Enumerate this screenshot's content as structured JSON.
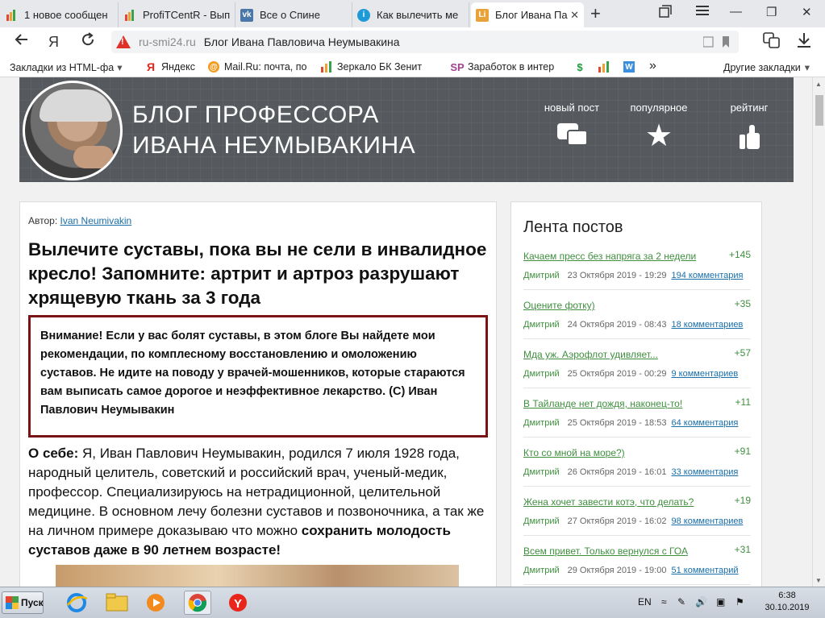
{
  "browser": {
    "tabs": [
      {
        "label": "1 новое сообщен",
        "icon": "chart-bars-icon",
        "color": "#e04a2f"
      },
      {
        "label": "ProfiTCentR - Вып",
        "icon": "chart-bars-icon",
        "color": "#e04a2f"
      },
      {
        "label": "Все о Спине",
        "icon": "vk-icon",
        "color": "#4a76a8"
      },
      {
        "label": "Как вылечить ме",
        "icon": "info-drop-icon",
        "color": "#1e9bd7"
      },
      {
        "label": "Блог Ивана Па",
        "icon": "blog-favicon-icon",
        "color": "#e8a23a"
      }
    ],
    "new_tab": "+",
    "window_controls": {
      "minimize": "—",
      "maximize": "❐",
      "close": "✕"
    },
    "address": {
      "domain": "ru-smi24.ru",
      "page_title": "Блог Ивана Павловича Неумывакина",
      "logo": "Я"
    },
    "bookmarks": [
      {
        "label": "Закладки из HTML-фа",
        "icon": "folder-icon"
      },
      {
        "label": "Яндекс",
        "icon": "yandex-icon"
      },
      {
        "label": "Mail.Ru: почта, по",
        "icon": "mailru-icon"
      },
      {
        "label": "Зеркало БК Зенит",
        "icon": "zenit-icon"
      },
      {
        "label": "Заработок в интер",
        "icon": "sp-icon"
      }
    ],
    "bookmarks_more": "»",
    "other_bookmarks": "Другие закладки"
  },
  "blog": {
    "title_line1": "БЛОГ ПРОФЕССОРА",
    "title_line2": "ИВАНА НЕУМЫВАКИНА",
    "nav": [
      {
        "label": "новый пост",
        "icon": "chat-bubbles-icon"
      },
      {
        "label": "популярное",
        "icon": "star-icon"
      },
      {
        "label": "рейтинг",
        "icon": "thumbs-up-icon"
      }
    ]
  },
  "article": {
    "author_label": "Автор:",
    "author_name": "Ivan Neumivakin",
    "headline": "Вылечите суставы, пока вы не сели в инвалидное кресло! Запомните: артрит и артроз разрушают хрящевую ткань за 3 года",
    "notice": "Внимание! Если у вас болят суставы, в этом блоге Вы найдете мои рекомендации, по комплесному восстановлению и омоложению суставов. Не идите на поводу у врачей-мошенников, которые стараются вам выписать самое дорогое и неэффективное лекарство. (С) Иван Павлович Неумывакин",
    "about_label": "О себе:",
    "about_text": " Я, Иван Павлович Неумывакин, родился 7 июля 1928 года, народный целитель, советский и российский врач, ученый-медик, профессор. Специализируюсь на нетрадиционной, целительной медицине. В основном лечу болезни суставов и позвоночника, а так же на личном примере доказываю что можно ",
    "about_bold_end": "сохранить молодость суставов даже в 90 летнем возрасте!"
  },
  "sidebar": {
    "title": "Лента постов",
    "posts": [
      {
        "title": "Качаем пресс без напряга за 2 недели",
        "score": "+145",
        "author": "Дмитрий",
        "date": "23 Октября 2019 - 19:29",
        "comments": "194 комментария"
      },
      {
        "title": "Оцените фотку)",
        "score": "+35",
        "author": "Дмитрий",
        "date": "24 Октября 2019 - 08:43",
        "comments": "18 комментариев"
      },
      {
        "title": "Мда уж. Аэрофлот удивляет...",
        "score": "+57",
        "author": "Дмитрий",
        "date": "25 Октября 2019 - 00:29",
        "comments": "9 комментариев"
      },
      {
        "title": "В Тайланде нет дождя, наконец-то!",
        "score": "+11",
        "author": "Дмитрий",
        "date": "25 Октября 2019 - 18:53",
        "comments": "64 комментария"
      },
      {
        "title": "Кто со мной на море?)",
        "score": "+91",
        "author": "Дмитрий",
        "date": "26 Октября 2019 - 16:01",
        "comments": "33 комментария"
      },
      {
        "title": "Жена хочет завести котэ, что делать?",
        "score": "+19",
        "author": "Дмитрий",
        "date": "27 Октября 2019 - 16:02",
        "comments": "98 комментариев"
      },
      {
        "title": "Всем привет. Только вернулся с ГОА",
        "score": "+31",
        "author": "Дмитрий",
        "date": "29 Октября 2019 - 19:00",
        "comments": "51 комментарий"
      }
    ]
  },
  "taskbar": {
    "start": "Пуск",
    "apps": [
      "ie-icon",
      "explorer-icon",
      "media-player-icon",
      "chrome-icon",
      "yandex-browser-icon"
    ],
    "lang": "EN",
    "time": "6:38",
    "date": "30.10.2019"
  }
}
